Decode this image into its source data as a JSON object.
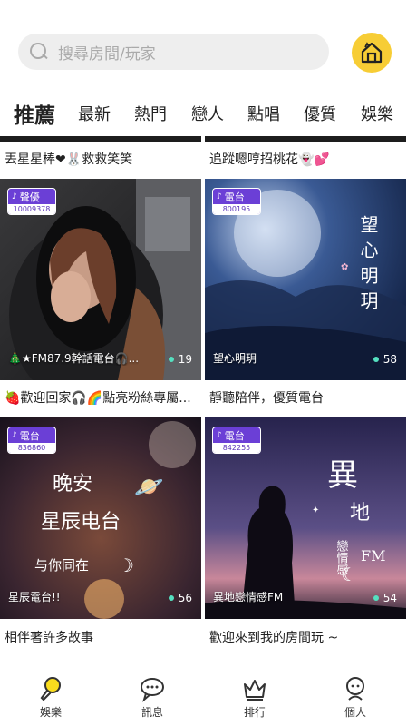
{
  "search": {
    "placeholder": "搜尋房間/玩家"
  },
  "tabs": [
    "推薦",
    "最新",
    "熱門",
    "戀人",
    "點唱",
    "優質",
    "娛樂"
  ],
  "top_titles": [
    "丟星星棒❤🐰救救笑笑",
    "追蹤嗯哼招桃花👻💕"
  ],
  "rooms": [
    {
      "category": "聲優",
      "id": "10009378",
      "name": "🎄★FM87.9幹話電台🎧...",
      "count": "19",
      "title": "🍓歡迎回家🎧🌈點亮粉絲專屬..."
    },
    {
      "category": "電台",
      "id": "800195",
      "name": "望心明玥",
      "count": "58",
      "title": "靜聽陪伴，優質電台"
    },
    {
      "category": "電台",
      "id": "836860",
      "name": "星辰電台!!",
      "count": "56",
      "title": "相伴著許多故事"
    },
    {
      "category": "電台",
      "id": "842255",
      "name": "異地戀情感FM",
      "count": "54",
      "title": "歡迎來到我的房間玩 ~"
    }
  ],
  "art_text": {
    "r2_big": "望心明玥",
    "r3_line1": "晚安",
    "r3_line2": "星辰电台",
    "r3_line3": "与你同在",
    "r4_big1": "異",
    "r4_big2": "地",
    "r4_mid": "戀情感",
    "r4_fm": "FM"
  },
  "bottom_nav": [
    "娛樂",
    "訊息",
    "排行",
    "個人"
  ],
  "colors": {
    "accent": "#fadd1e",
    "badge": "#6b3fd6",
    "online_dot": "#55e0c0"
  }
}
